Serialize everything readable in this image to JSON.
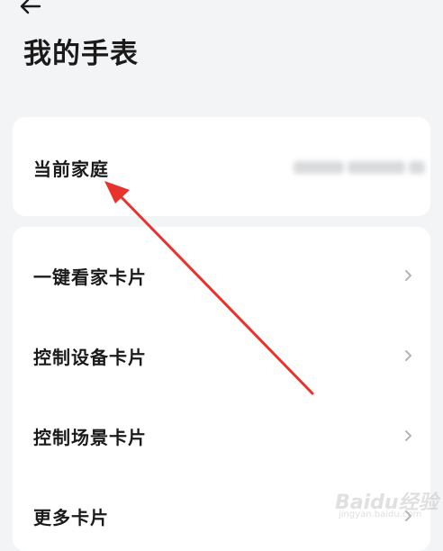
{
  "header": {
    "back_icon": "arrow-left-icon",
    "title": "我的手表"
  },
  "family_card": {
    "label": "当前家庭",
    "value_blurred": true
  },
  "cards_section": {
    "items": [
      {
        "label": "一键看家卡片",
        "icon": "chevron-right-icon"
      },
      {
        "label": "控制设备卡片",
        "icon": "chevron-right-icon"
      },
      {
        "label": "控制场景卡片",
        "icon": "chevron-right-icon"
      },
      {
        "label": "更多卡片",
        "icon": "chevron-right-icon"
      }
    ]
  },
  "annotation": {
    "color": "#e8322c",
    "points_to": "当前家庭"
  },
  "watermark": {
    "brand": "Baidu经验",
    "sub": "jingyan.baidu.com"
  },
  "colors": {
    "background": "#f3f4f6",
    "card": "#ffffff",
    "text": "#1a1a1a",
    "chevron": "#b5b5b5"
  }
}
